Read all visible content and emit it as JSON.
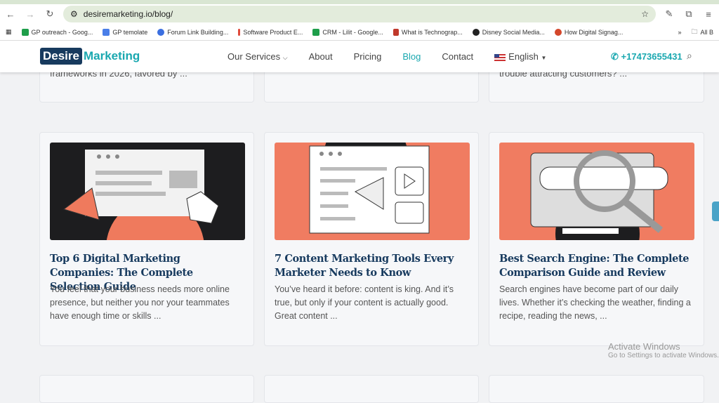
{
  "browser": {
    "url": "desiremarketing.io/blog/",
    "bookmarks": [
      {
        "label": "GP outreach - Goog...",
        "color": "#1e9e4a"
      },
      {
        "label": "GP temolate",
        "color": "#4a7ee8"
      },
      {
        "label": "Forum Link Building...",
        "color": "#3b6fe0"
      },
      {
        "label": "Software Product E...",
        "color": "#e04a3b"
      },
      {
        "label": "CRM - Lilit - Google...",
        "color": "#1e9e4a"
      },
      {
        "label": "What is Technograp...",
        "color": "#c0392b"
      },
      {
        "label": "Disney Social Media...",
        "color": "#222222"
      },
      {
        "label": "How Digital Signag...",
        "color": "#d4472b"
      }
    ],
    "all_bookmarks": "All B"
  },
  "site": {
    "logo_a": "Desire",
    "logo_b": "Marketing",
    "nav": [
      "Our Services",
      "About",
      "Pricing",
      "Blog",
      "Contact"
    ],
    "language": "English",
    "phone": "+17473655431"
  },
  "partial_cards": [
    {
      "excerpt": "frameworks in 2026, favored by ..."
    },
    {
      "excerpt": ""
    },
    {
      "excerpt": "trouble attracting customers? ..."
    }
  ],
  "posts": [
    {
      "title": "Top 6 Digital Marketing Companies: The Complete Selection Guide",
      "excerpt": "You feel that your business needs more online presence, but neither you nor your teammates have enough time or skills ..."
    },
    {
      "title": "7 Content Marketing Tools Every Marketer Needs to Know",
      "excerpt": "You’ve heard it before: content is king. And it’s true, but only if your content is actually good. Great content ..."
    },
    {
      "title": "Best Search Engine: The Complete Comparison Guide and Review",
      "excerpt": "Search engines have become part of our daily lives. Whether it’s checking the weather, finding a recipe, reading the news, ..."
    }
  ],
  "watermark": {
    "title": "Activate Windows",
    "sub": "Go to Settings to activate Windows."
  }
}
